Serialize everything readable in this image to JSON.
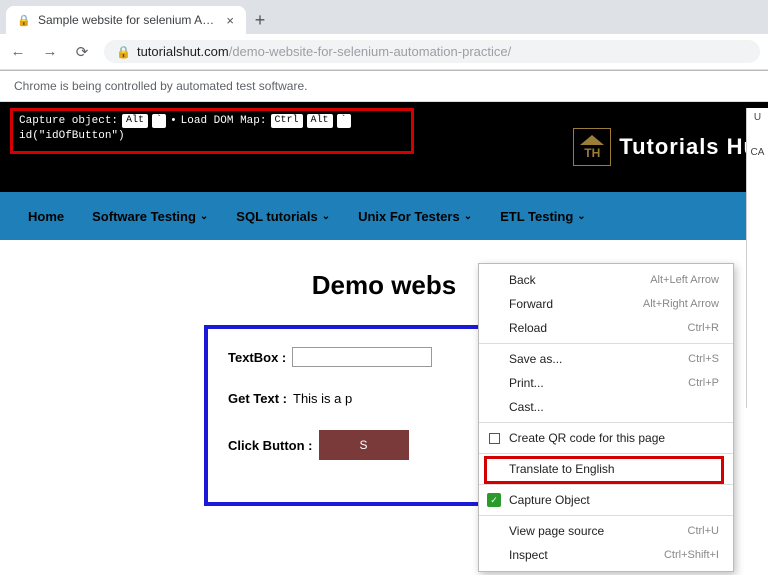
{
  "browser": {
    "tab_title": "Sample website for selenium Au...",
    "url_domain": "tutorialshut.com",
    "url_path": "/demo-website-for-selenium-automation-practice/",
    "infobar": "Chrome is being controlled by automated test software."
  },
  "capture_bar": {
    "label1": "Capture object:",
    "key1": "Alt",
    "key2": "`",
    "bullet": "•",
    "label2": "Load DOM Map:",
    "key3": "Ctrl",
    "key4": "Alt",
    "key5": "`",
    "locator": "id(\"idOfButton\")"
  },
  "header": {
    "logo_text": "TH",
    "brand": "Tutorials Hu"
  },
  "nav": {
    "items": [
      {
        "label": "Home",
        "dropdown": false
      },
      {
        "label": "Software Testing",
        "dropdown": true
      },
      {
        "label": "SQL tutorials",
        "dropdown": true
      },
      {
        "label": "Unix For Testers",
        "dropdown": true
      },
      {
        "label": "ETL Testing",
        "dropdown": true
      }
    ]
  },
  "demo": {
    "title": "Demo webs",
    "textbox_label": "TextBox :",
    "gettext_label": "Get Text :",
    "gettext_value": "This is a p",
    "clickbutton_label": "Click Button :",
    "button_text": "S"
  },
  "context_menu": {
    "items": [
      {
        "label": "Back",
        "shortcut": "Alt+Left Arrow",
        "icon": null
      },
      {
        "label": "Forward",
        "shortcut": "Alt+Right Arrow",
        "icon": null
      },
      {
        "label": "Reload",
        "shortcut": "Ctrl+R",
        "icon": null
      },
      {
        "sep": true
      },
      {
        "label": "Save as...",
        "shortcut": "Ctrl+S",
        "icon": null
      },
      {
        "label": "Print...",
        "shortcut": "Ctrl+P",
        "icon": null
      },
      {
        "label": "Cast...",
        "shortcut": "",
        "icon": null
      },
      {
        "sep": true
      },
      {
        "label": "Create QR code for this page",
        "shortcut": "",
        "icon": "qr"
      },
      {
        "sep": true
      },
      {
        "label": "Translate to English",
        "shortcut": "",
        "icon": null
      },
      {
        "sep": true
      },
      {
        "label": "Capture Object",
        "shortcut": "",
        "icon": "green"
      },
      {
        "sep": true
      },
      {
        "label": "View page source",
        "shortcut": "Ctrl+U",
        "icon": null
      },
      {
        "label": "Inspect",
        "shortcut": "Ctrl+Shift+I",
        "icon": null
      }
    ]
  },
  "side": {
    "u": "U",
    "ca": "CA"
  }
}
